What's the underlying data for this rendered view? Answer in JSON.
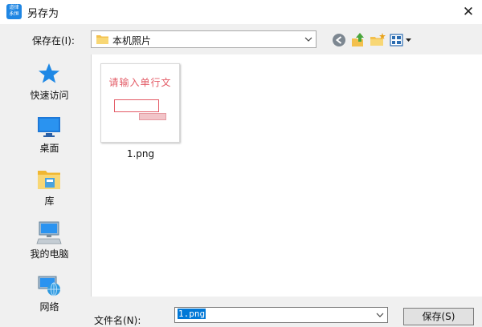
{
  "window": {
    "title": "另存为",
    "app_icon_text": "道律 永恒",
    "close_glyph": "✕"
  },
  "location": {
    "label": "保存在(I):",
    "value": "本机照片"
  },
  "places": [
    {
      "label": "快速访问",
      "icon": "star-icon"
    },
    {
      "label": "桌面",
      "icon": "desktop-icon"
    },
    {
      "label": "库",
      "icon": "library-icon"
    },
    {
      "label": "我的电脑",
      "icon": "computer-icon"
    },
    {
      "label": "网络",
      "icon": "network-icon"
    }
  ],
  "files": [
    {
      "name": "1.png",
      "thumbnail_text": "请输入单行文"
    }
  ],
  "filename": {
    "label": "文件名(N):",
    "value": "1.png"
  },
  "buttons": {
    "save": "保存(S)"
  },
  "colors": {
    "accent": "#0078d7",
    "thumb_red": "#e35b66"
  }
}
